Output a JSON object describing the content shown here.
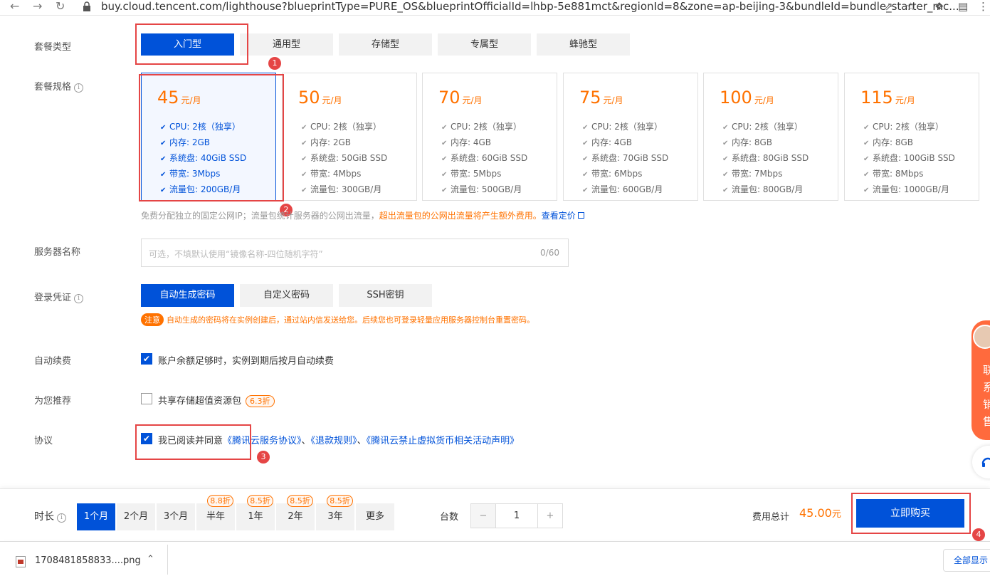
{
  "browser": {
    "url": "buy.cloud.tencent.com/lighthouse?blueprintType=PURE_OS&blueprintOfficialId=lhbp-5e881mct&regionId=8&zone=ap-beijing-3&bundleId=bundle_starter_mc..."
  },
  "plan_type": {
    "label": "套餐类型",
    "options": [
      "入门型",
      "通用型",
      "存储型",
      "专属型",
      "蜂驰型"
    ],
    "selected": "入门型"
  },
  "plan_spec": {
    "label": "套餐规格",
    "cards": [
      {
        "price": "45",
        "unit": "元/月",
        "specs": [
          "CPU: 2核（独享）",
          "内存: 2GB",
          "系统盘: 40GiB SSD",
          "带宽: 3Mbps",
          "流量包: 200GB/月"
        ]
      },
      {
        "price": "50",
        "unit": "元/月",
        "specs": [
          "CPU: 2核（独享）",
          "内存: 2GB",
          "系统盘: 50GiB SSD",
          "带宽: 4Mbps",
          "流量包: 300GB/月"
        ]
      },
      {
        "price": "70",
        "unit": "元/月",
        "specs": [
          "CPU: 2核（独享）",
          "内存: 4GB",
          "系统盘: 60GiB SSD",
          "带宽: 5Mbps",
          "流量包: 500GB/月"
        ]
      },
      {
        "price": "75",
        "unit": "元/月",
        "specs": [
          "CPU: 2核（独享）",
          "内存: 4GB",
          "系统盘: 70GiB SSD",
          "带宽: 6Mbps",
          "流量包: 600GB/月"
        ]
      },
      {
        "price": "100",
        "unit": "元/月",
        "specs": [
          "CPU: 2核（独享）",
          "内存: 8GB",
          "系统盘: 80GiB SSD",
          "带宽: 7Mbps",
          "流量包: 800GB/月"
        ]
      },
      {
        "price": "115",
        "unit": "元/月",
        "specs": [
          "CPU: 2核（独享）",
          "内存: 8GB",
          "系统盘: 100GiB SSD",
          "带宽: 8Mbps",
          "流量包: 1000GB/月"
        ]
      }
    ],
    "note_prefix": "免费分配独立的固定公网IP；流量包统计服务器的公网出流量，",
    "note_warn": "超出流量包的公网出流量将产生额外费用。",
    "note_link": "查看定价"
  },
  "server_name": {
    "label": "服务器名称",
    "placeholder": "可选，不填默认使用“镜像名称-四位随机字符”",
    "counter": "0/60"
  },
  "login": {
    "label": "登录凭证",
    "options": [
      "自动生成密码",
      "自定义密码",
      "SSH密钥"
    ],
    "tip_tag": "注意",
    "tip_text": "自动生成的密码将在实例创建后，通过站内信发送给您。后续您也可登录轻量应用服务器控制台重置密码。"
  },
  "auto_renew": {
    "label": "自动续费",
    "text": "账户余额足够时，实例到期后按月自动续费"
  },
  "recommend": {
    "label": "为您推荐",
    "text": "共享存储超值资源包",
    "discount": "6.3折"
  },
  "agreement": {
    "label": "协议",
    "text": "我已阅读并同意",
    "links": [
      "《腾讯云服务协议》",
      "《退款规则》",
      "《腾讯云禁止虚拟货币相关活动声明》"
    ],
    "sep": "、"
  },
  "footer": {
    "duration_label": "时长",
    "durations": [
      {
        "label": "1个月",
        "tag": ""
      },
      {
        "label": "2个月",
        "tag": ""
      },
      {
        "label": "3个月",
        "tag": ""
      },
      {
        "label": "半年",
        "tag": "8.8折"
      },
      {
        "label": "1年",
        "tag": "8.5折"
      },
      {
        "label": "2年",
        "tag": "8.5折"
      },
      {
        "label": "3年",
        "tag": "8.5折"
      },
      {
        "label": "更多",
        "tag": ""
      }
    ],
    "qty_label": "台数",
    "qty_minus": "−",
    "qty_value": "1",
    "qty_plus": "+",
    "total_label": "费用总计",
    "total_value": "45.00",
    "total_unit": "元",
    "buy_label": "立即购买"
  },
  "annotations": [
    "1",
    "2",
    "3",
    "4"
  ],
  "download": {
    "file": "1708481858833....png",
    "show_all": "全部显示"
  },
  "side_widget": {
    "text": "联系销售"
  }
}
